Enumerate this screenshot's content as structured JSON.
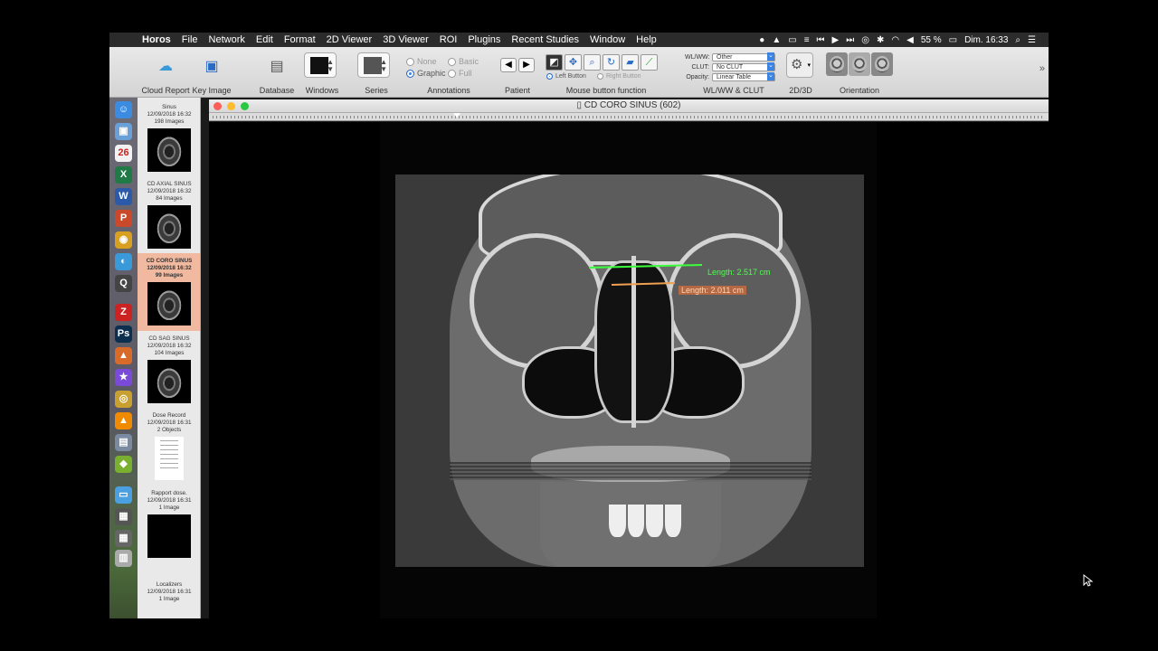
{
  "menubar": {
    "app": "Horos",
    "items": [
      "File",
      "Network",
      "Edit",
      "Format",
      "2D Viewer",
      "3D Viewer",
      "ROI",
      "Plugins",
      "Recent Studies",
      "Window",
      "Help"
    ],
    "battery": "55 %",
    "clock": "Dim. 16:33"
  },
  "toolbar": {
    "cloud_report": "Cloud Report",
    "key_image": "Key Image",
    "database": "Database",
    "windows": "Windows",
    "series": "Series",
    "annotations": "Annotations",
    "ann_none": "None",
    "ann_basic": "Basic",
    "ann_graphic": "Graphic",
    "ann_full": "Full",
    "patient": "Patient",
    "left_button": "Left Button",
    "right_button": "Right Button",
    "mouse_function": "Mouse button function",
    "wlww_label": "WL/WW:",
    "wlww_value": "Other",
    "clut_label": "CLUT:",
    "clut_value": "No CLUT",
    "opacity_label": "Opacity:",
    "opacity_value": "Linear Table",
    "wlww_clut": "WL/WW & CLUT",
    "twod3d": "2D/3D",
    "orientation": "Orientation",
    "overflow": "»"
  },
  "series": [
    {
      "name": "Sinus",
      "date": "12/09/2018 16:32",
      "count": "198 Images"
    },
    {
      "name": "CD AXIAL SINUS",
      "date": "12/09/2018 16:32",
      "count": "84 Images"
    },
    {
      "name": "CD CORO SINUS",
      "date": "12/09/2018 16:32",
      "count": "99 Images"
    },
    {
      "name": "CD SAG SINUS",
      "date": "12/09/2018 16:32",
      "count": "104 Images"
    },
    {
      "name": "Dose Record",
      "date": "12/09/2018 16:31",
      "count": "2 Objects"
    },
    {
      "name": "Rapport dose.",
      "date": "12/09/2018 16:31",
      "count": "1 Image"
    },
    {
      "name": "Localizers",
      "date": "12/09/2018 16:31",
      "count": "1 Image"
    }
  ],
  "dock_icons": [
    {
      "name": "finder-icon",
      "glyph": "☺",
      "color": "#3b8be0"
    },
    {
      "name": "preview-icon",
      "glyph": "▣",
      "color": "#6aa0d8"
    },
    {
      "name": "calendar-icon",
      "glyph": "26",
      "color": "#f2f2f2"
    },
    {
      "name": "excel-icon",
      "glyph": "X",
      "color": "#1f7a45"
    },
    {
      "name": "word-icon",
      "glyph": "W",
      "color": "#2b5aa8"
    },
    {
      "name": "powerpoint-icon",
      "glyph": "P",
      "color": "#c9492a"
    },
    {
      "name": "chrome-icon",
      "glyph": "◉",
      "color": "#d8a020"
    },
    {
      "name": "horos-icon",
      "glyph": "◐",
      "color": "#3a9ad9"
    },
    {
      "name": "quicktime-icon",
      "glyph": "Q",
      "color": "#444"
    },
    {
      "name": "zotero-icon",
      "glyph": "Z",
      "color": "#c22"
    },
    {
      "name": "photoshop-icon",
      "glyph": "Ps",
      "color": "#0d2f4f"
    },
    {
      "name": "pyramid-icon",
      "glyph": "▲",
      "color": "#d86a2a"
    },
    {
      "name": "imovie-icon",
      "glyph": "★",
      "color": "#7a4ad8"
    },
    {
      "name": "speaker-icon",
      "glyph": "◎",
      "color": "#c8a030"
    },
    {
      "name": "vlc-icon",
      "glyph": "▲",
      "color": "#f08a00"
    },
    {
      "name": "photo-icon",
      "glyph": "▤",
      "color": "#7a8aa0"
    },
    {
      "name": "android-icon",
      "glyph": "◆",
      "color": "#7ab030"
    },
    {
      "name": "folder-icon",
      "glyph": "▭",
      "color": "#4aa0e0"
    },
    {
      "name": "stack-icon",
      "glyph": "▦",
      "color": "#555"
    },
    {
      "name": "stack2-icon",
      "glyph": "▦",
      "color": "#666"
    },
    {
      "name": "trash-icon",
      "glyph": "▥",
      "color": "#aaa"
    }
  ],
  "viewer": {
    "title": "CD CORO SINUS (602)",
    "length1": "Length: 2.517 cm",
    "length2": "Length: 2.011 cm"
  },
  "colors": {
    "measure_green": "#3cff3c",
    "measure_orange": "#f0a050",
    "selected_series": "#f0b9a0",
    "accent": "#3b84e4"
  }
}
